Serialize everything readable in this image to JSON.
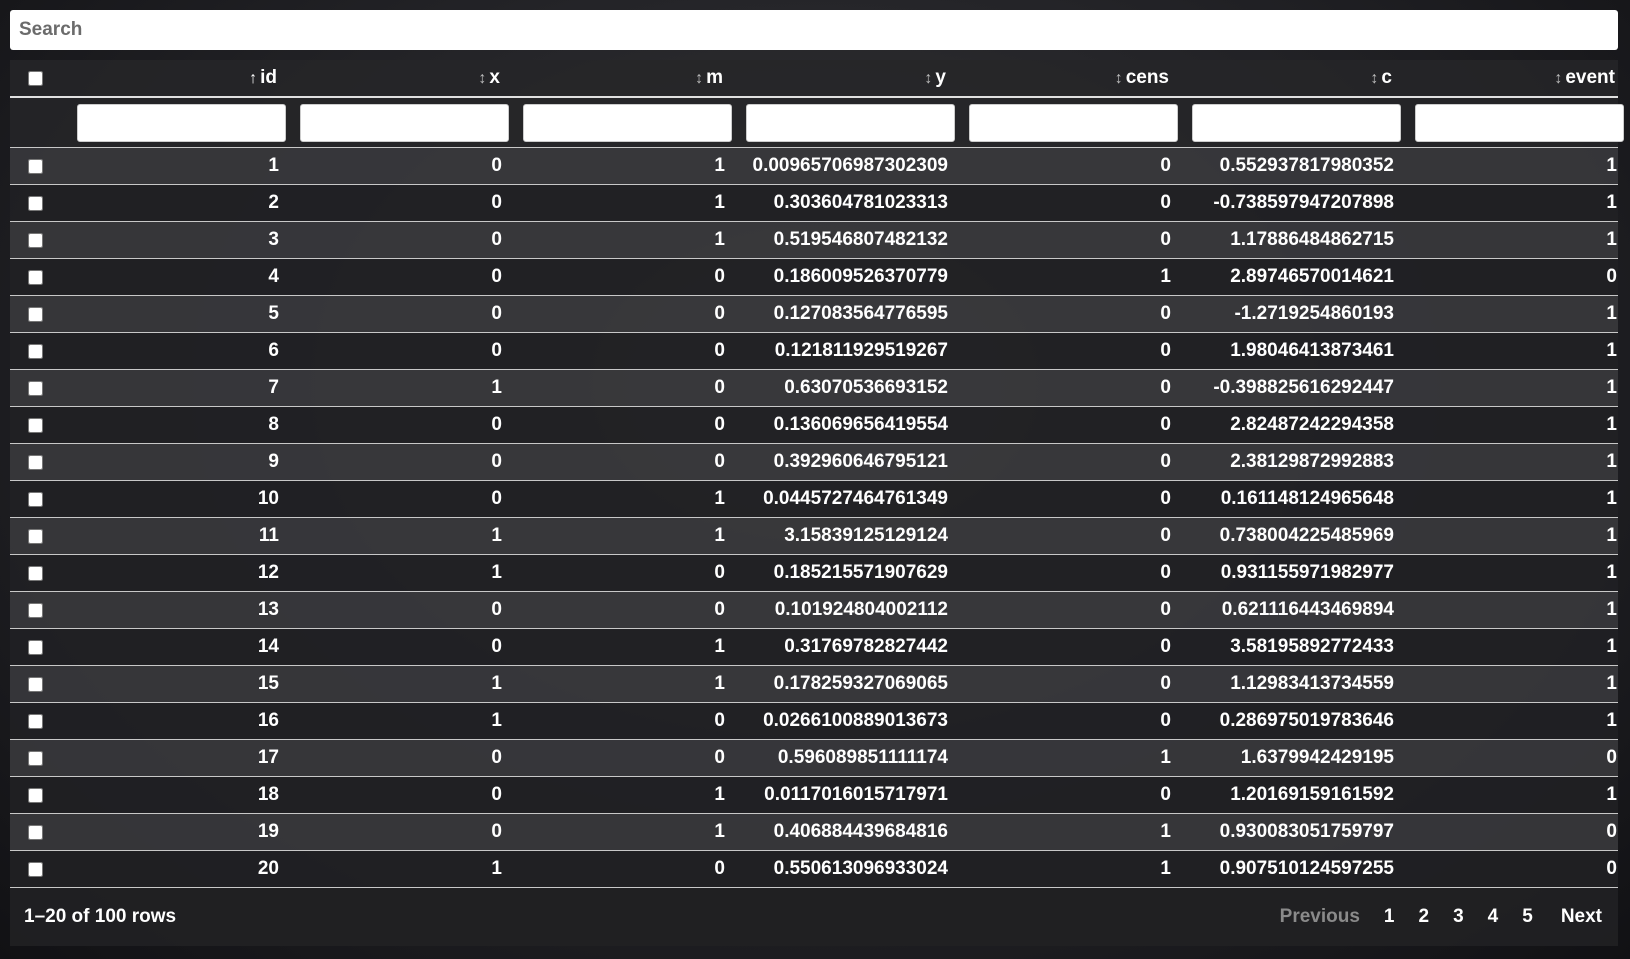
{
  "search": {
    "placeholder": "Search"
  },
  "columns": [
    {
      "label": "id",
      "sort_icon": "↑"
    },
    {
      "label": "x",
      "sort_icon": "↕"
    },
    {
      "label": "m",
      "sort_icon": "↕"
    },
    {
      "label": "y",
      "sort_icon": "↕"
    },
    {
      "label": "cens",
      "sort_icon": "↕"
    },
    {
      "label": "c",
      "sort_icon": "↕"
    },
    {
      "label": "event",
      "sort_icon": "↕"
    }
  ],
  "rows": [
    [
      "1",
      "0",
      "1",
      "0.00965706987302309",
      "0",
      "0.552937817980352",
      "1"
    ],
    [
      "2",
      "0",
      "1",
      "0.303604781023313",
      "0",
      "-0.738597947207898",
      "1"
    ],
    [
      "3",
      "0",
      "1",
      "0.519546807482132",
      "0",
      "1.17886484862715",
      "1"
    ],
    [
      "4",
      "0",
      "0",
      "0.186009526370779",
      "1",
      "2.89746570014621",
      "0"
    ],
    [
      "5",
      "0",
      "0",
      "0.127083564776595",
      "0",
      "-1.2719254860193",
      "1"
    ],
    [
      "6",
      "0",
      "0",
      "0.121811929519267",
      "0",
      "1.98046413873461",
      "1"
    ],
    [
      "7",
      "1",
      "0",
      "0.63070536693152",
      "0",
      "-0.398825616292447",
      "1"
    ],
    [
      "8",
      "0",
      "0",
      "0.136069656419554",
      "0",
      "2.82487242294358",
      "1"
    ],
    [
      "9",
      "0",
      "0",
      "0.392960646795121",
      "0",
      "2.38129872992883",
      "1"
    ],
    [
      "10",
      "0",
      "1",
      "0.0445727464761349",
      "0",
      "0.161148124965648",
      "1"
    ],
    [
      "11",
      "1",
      "1",
      "3.15839125129124",
      "0",
      "0.738004225485969",
      "1"
    ],
    [
      "12",
      "1",
      "0",
      "0.185215571907629",
      "0",
      "0.931155971982977",
      "1"
    ],
    [
      "13",
      "0",
      "0",
      "0.101924804002112",
      "0",
      "0.621116443469894",
      "1"
    ],
    [
      "14",
      "0",
      "1",
      "0.31769782827442",
      "0",
      "3.58195892772433",
      "1"
    ],
    [
      "15",
      "1",
      "1",
      "0.178259327069065",
      "0",
      "1.12983413734559",
      "1"
    ],
    [
      "16",
      "1",
      "0",
      "0.0266100889013673",
      "0",
      "0.286975019783646",
      "1"
    ],
    [
      "17",
      "0",
      "0",
      "0.596089851111174",
      "1",
      "1.6379942429195",
      "0"
    ],
    [
      "18",
      "0",
      "1",
      "0.0117016015717971",
      "0",
      "1.20169159161592",
      "1"
    ],
    [
      "19",
      "0",
      "1",
      "0.406884439684816",
      "1",
      "0.930083051759797",
      "0"
    ],
    [
      "20",
      "1",
      "0",
      "0.550613096933024",
      "1",
      "0.907510124597255",
      "0"
    ]
  ],
  "footer": {
    "info": "1–20 of 100 rows",
    "previous": "Previous",
    "pages": [
      "1",
      "2",
      "3",
      "4",
      "5"
    ],
    "next": "Next"
  }
}
